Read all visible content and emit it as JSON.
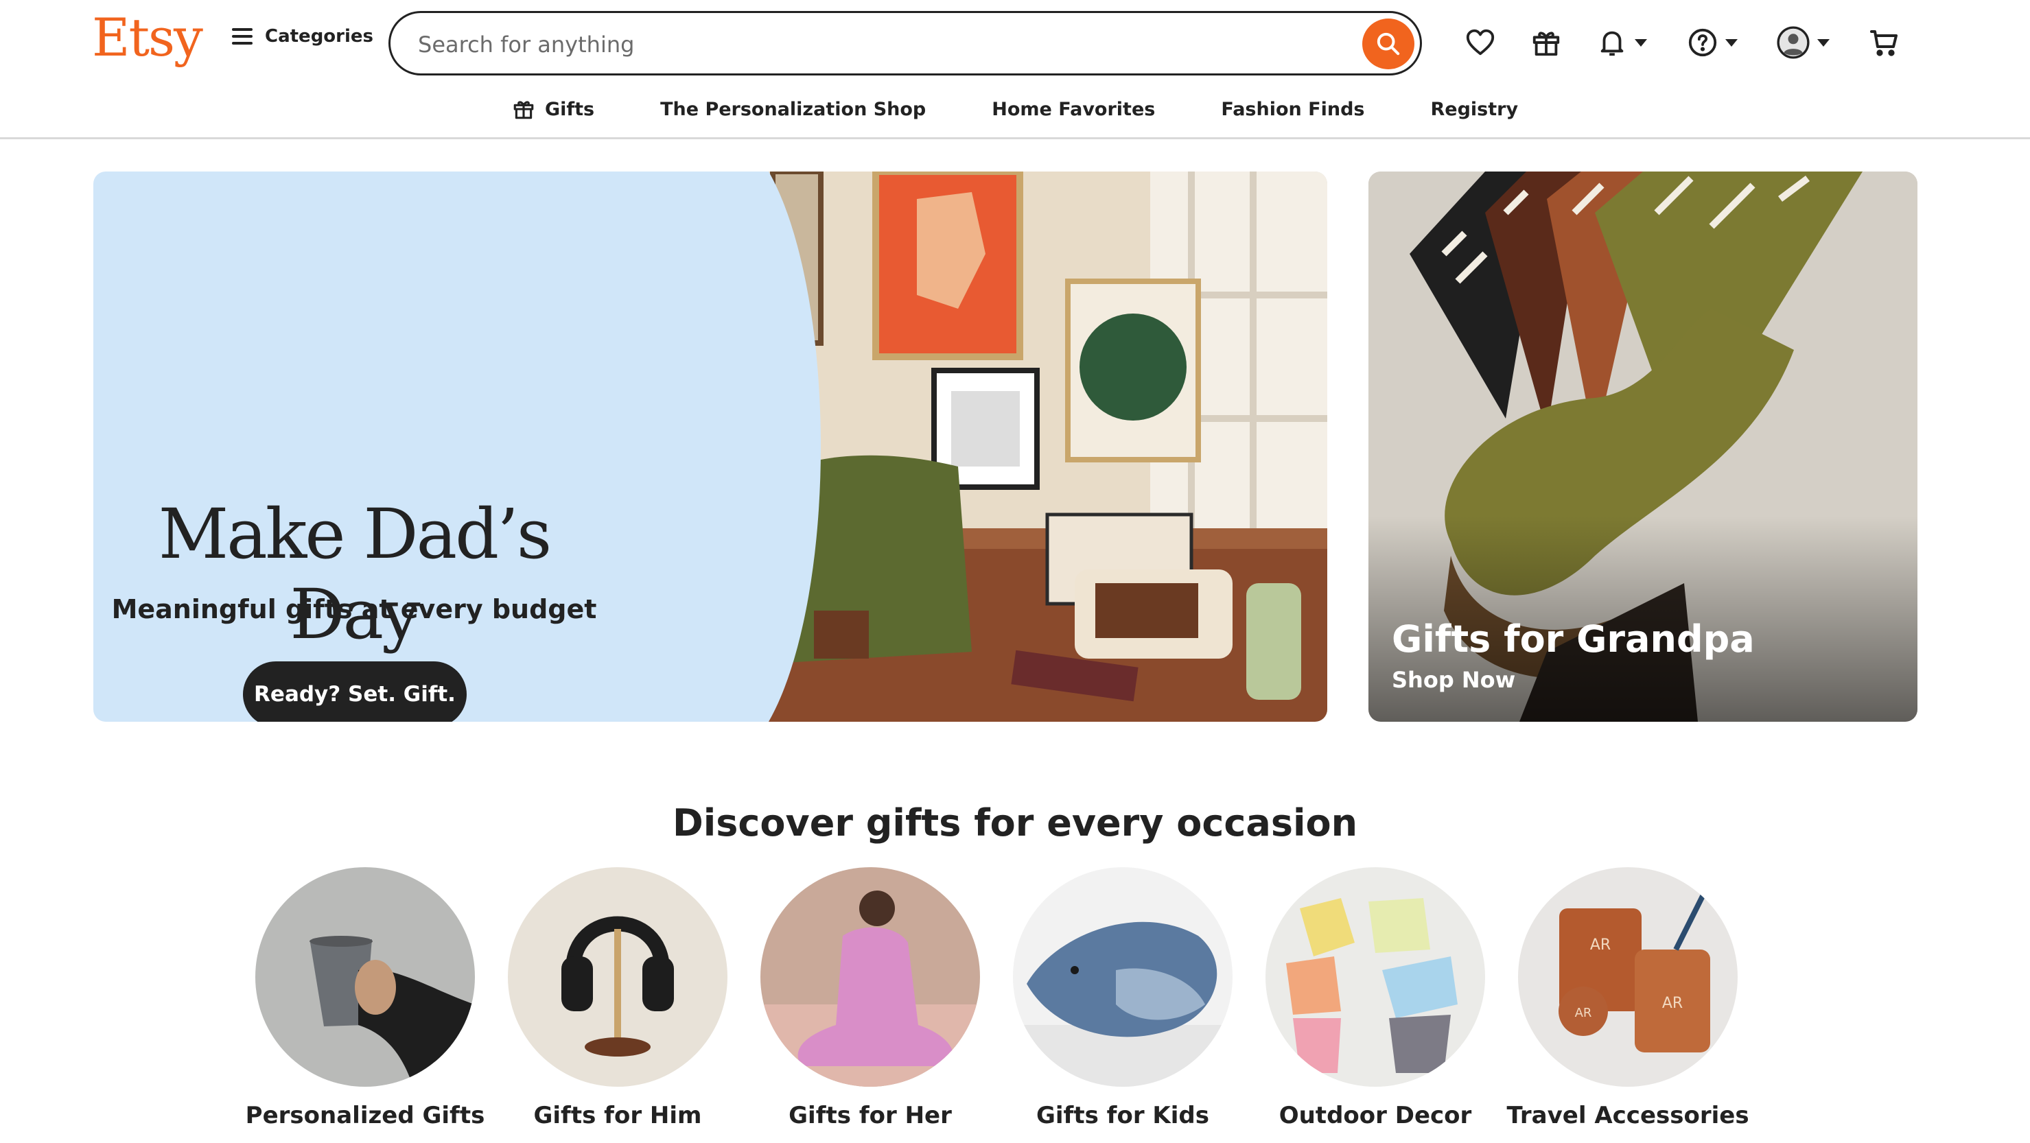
{
  "brand": {
    "logo_text": "Etsy",
    "accent_color": "#F1641E"
  },
  "header": {
    "categories_label": "Categories",
    "search": {
      "placeholder": "Search for anything",
      "value": ""
    },
    "icons": [
      "heart-icon",
      "gift-icon",
      "bell-icon",
      "help-icon",
      "avatar-icon",
      "cart-icon"
    ]
  },
  "subnav": {
    "items": [
      {
        "label": "Gifts",
        "icon": "gift-icon"
      },
      {
        "label": "The Personalization Shop"
      },
      {
        "label": "Home Favorites"
      },
      {
        "label": "Fashion Finds"
      },
      {
        "label": "Registry"
      }
    ]
  },
  "hero": {
    "title": "Make Dad’s Day",
    "subtitle": "Meaningful gifts at every budget",
    "cta_label": "Ready? Set. Gift.",
    "background_color": "#D0E6F9"
  },
  "promo": {
    "title": "Gifts for Grandpa",
    "link_label": "Shop Now"
  },
  "discover": {
    "title": "Discover gifts for every occasion",
    "items": [
      {
        "label": "Personalized Gifts"
      },
      {
        "label": "Gifts for Him"
      },
      {
        "label": "Gifts for Her"
      },
      {
        "label": "Gifts for Kids"
      },
      {
        "label": "Outdoor Decor"
      },
      {
        "label": "Travel Accessories"
      }
    ]
  }
}
